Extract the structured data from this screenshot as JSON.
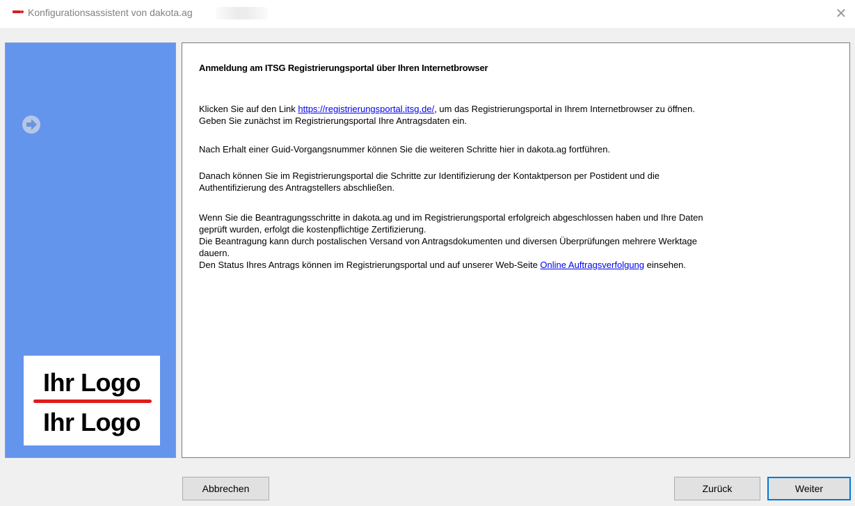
{
  "window": {
    "title": "Konfigurationsassistent von dakota.ag",
    "close_icon": "close-icon",
    "app_icon": "dakota-app-icon"
  },
  "sidebar": {
    "background": "#6495ed",
    "step_icon": "arrow-right-circle-icon",
    "logo": {
      "top_text": "Ihr Logo",
      "bottom_text": "Ihr Logo",
      "line_color": "#e01b1b"
    }
  },
  "content": {
    "heading": "Anmeldung am ITSG Registrierungsportal über Ihren Internetbrowser",
    "p1": {
      "before_link": "Klicken Sie auf den Link ",
      "link": "https://registrierungsportal.itsg.de/",
      "after_link": ", um das Registrierungsportal in Ihrem Internetbrowser zu öffnen.",
      "line2": "Geben Sie zunächst im Registrierungsportal Ihre Antragsdaten ein."
    },
    "p2": "Nach Erhalt einer Guid-Vorgangsnummer können Sie die weiteren Schritte hier in dakota.ag fortführen.",
    "p3": {
      "line1": "Danach können Sie im Registrierungsportal die Schritte zur Identifizierung der Kontaktperson per Postident und die",
      "line2": "Authentifizierung des Antragstellers abschließen."
    },
    "p4": {
      "line1": "Wenn Sie die Beantragungsschritte in dakota.ag und im Registrierungsportal erfolgreich abgeschlossen haben und Ihre Daten",
      "line2": "geprüft wurden, erfolgt die kostenpflichtige Zertifizierung.",
      "line3": "Die Beantragung kann durch postalischen Versand von Antragsdokumenten und diversen Überprüfungen mehrere Werktage",
      "line4": "dauern.",
      "line5_before_link": "Den Status Ihres Antrags können im Registrierungsportal und auf unserer Web-Seite ",
      "line5_link": "Online Auftragsverfolgung",
      "line5_after_link": " einsehen."
    },
    "link_color": "#0000ee"
  },
  "buttons": {
    "cancel": "Abbrechen",
    "back": "Zurück",
    "next": "Weiter",
    "focus_color": "#0078d7"
  }
}
